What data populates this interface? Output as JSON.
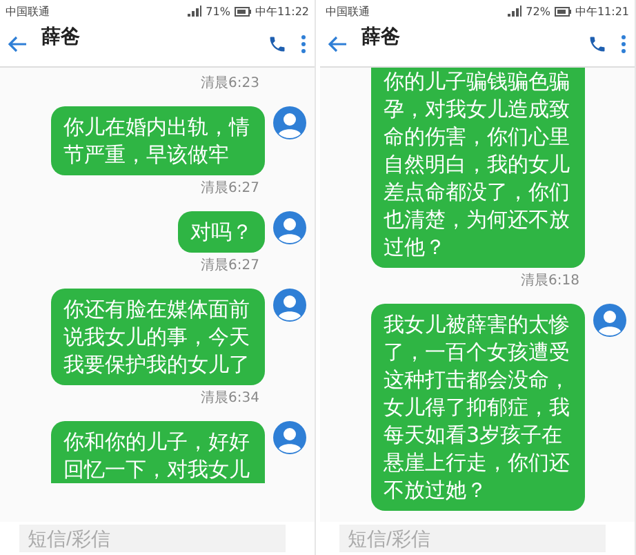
{
  "screens": [
    {
      "status_bar": {
        "carrier": "中国联通",
        "battery": "71%",
        "time": "中午11:22"
      },
      "header": {
        "title": "薛爸"
      },
      "messages": [
        {
          "kind": "time",
          "text": "清晨6:23"
        },
        {
          "kind": "bubble",
          "text": "你儿在婚内出轨，情节严重，早该做牢",
          "cut_off": false
        },
        {
          "kind": "time",
          "text": "清晨6:27"
        },
        {
          "kind": "bubble",
          "text": "对吗？",
          "cut_off": false
        },
        {
          "kind": "time",
          "text": "清晨6:27"
        },
        {
          "kind": "bubble",
          "text": "你还有脸在媒体面前说我女儿的事，今天我要保护我的女儿了",
          "cut_off": false
        },
        {
          "kind": "time",
          "text": "清晨6:34"
        },
        {
          "kind": "bubble",
          "text": "你和你的儿子，好好回忆一下，对我女儿",
          "cut_off": true
        }
      ],
      "input": {
        "placeholder": "短信/彩信"
      }
    },
    {
      "status_bar": {
        "carrier": "中国联通",
        "battery": "72%",
        "time": "中午11:21"
      },
      "header": {
        "title": "薛爸"
      },
      "messages": [
        {
          "kind": "bubble",
          "text": "你的儿子骗钱骗色骗孕，对我女儿造成致命的伤害，你们心里自然明白，我的女儿差点命都没了，你们也清楚，为何还不放过他？",
          "cut_off": true
        },
        {
          "kind": "time",
          "text": "清晨6:18"
        },
        {
          "kind": "bubble",
          "text": "我女儿被薛害的太惨了，一百个女孩遭受这种打击都会没命，女儿得了抑郁症，我每天如看3岁孩子在悬崖上行走，你们还不放过她？",
          "cut_off": false
        }
      ],
      "input": {
        "placeholder": "短信/彩信"
      }
    }
  ]
}
